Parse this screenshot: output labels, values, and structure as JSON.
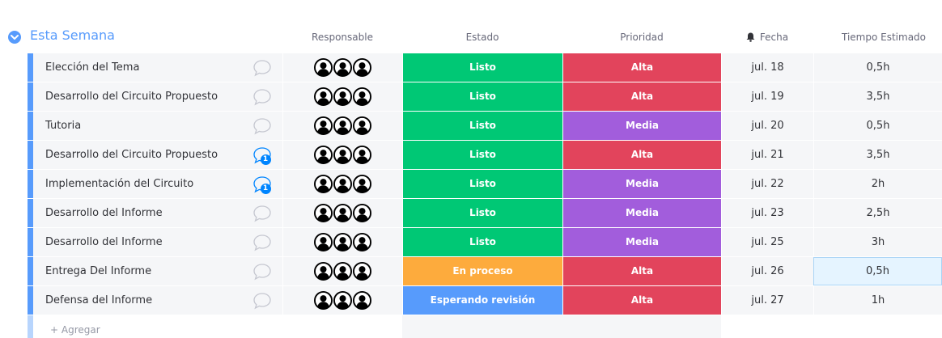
{
  "group": {
    "title": "Esta Semana",
    "color": "#579bfc"
  },
  "columns": {
    "responsable": "Responsable",
    "estado": "Estado",
    "prioridad": "Prioridad",
    "fecha": "Fecha",
    "fecha_icon": "bell-icon",
    "tiempo": "Tiempo Estimado"
  },
  "rows": [
    {
      "name": "Elección del Tema",
      "updates": "",
      "estado": "Listo",
      "estado_color": "#00c875",
      "prioridad": "Alta",
      "prioridad_color": "#e2445c",
      "fecha": "jul. 18",
      "tiempo": "0,5h"
    },
    {
      "name": "Desarrollo del Circuito Propuesto",
      "updates": "",
      "estado": "Listo",
      "estado_color": "#00c875",
      "prioridad": "Alta",
      "prioridad_color": "#e2445c",
      "fecha": "jul. 19",
      "tiempo": "3,5h"
    },
    {
      "name": "Tutoria",
      "updates": "",
      "estado": "Listo",
      "estado_color": "#00c875",
      "prioridad": "Media",
      "prioridad_color": "#a25ddc",
      "fecha": "jul. 20",
      "tiempo": "0,5h"
    },
    {
      "name": "Desarrollo del Circuito Propuesto",
      "updates": "1",
      "estado": "Listo",
      "estado_color": "#00c875",
      "prioridad": "Alta",
      "prioridad_color": "#e2445c",
      "fecha": "jul. 21",
      "tiempo": "3,5h"
    },
    {
      "name": "Implementación del Circuito",
      "updates": "1",
      "estado": "Listo",
      "estado_color": "#00c875",
      "prioridad": "Media",
      "prioridad_color": "#a25ddc",
      "fecha": "jul. 22",
      "tiempo": "2h"
    },
    {
      "name": "Desarrollo del Informe",
      "updates": "",
      "estado": "Listo",
      "estado_color": "#00c875",
      "prioridad": "Media",
      "prioridad_color": "#a25ddc",
      "fecha": "jul. 23",
      "tiempo": "2,5h"
    },
    {
      "name": "Desarrollo del Informe",
      "updates": "",
      "estado": "Listo",
      "estado_color": "#00c875",
      "prioridad": "Media",
      "prioridad_color": "#a25ddc",
      "fecha": "jul. 25",
      "tiempo": "3h"
    },
    {
      "name": "Entrega Del Informe",
      "updates": "",
      "estado": "En proceso",
      "estado_color": "#fdab3d",
      "prioridad": "Alta",
      "prioridad_color": "#e2445c",
      "fecha": "jul. 26",
      "tiempo": "0,5h",
      "selected": true
    },
    {
      "name": "Defensa del Informe",
      "updates": "",
      "estado": "Esperando revisión",
      "estado_color": "#579bfc",
      "prioridad": "Alta",
      "prioridad_color": "#e2445c",
      "fecha": "jul. 27",
      "tiempo": "1h"
    }
  ],
  "add_row": {
    "label": "+ Agregar"
  }
}
